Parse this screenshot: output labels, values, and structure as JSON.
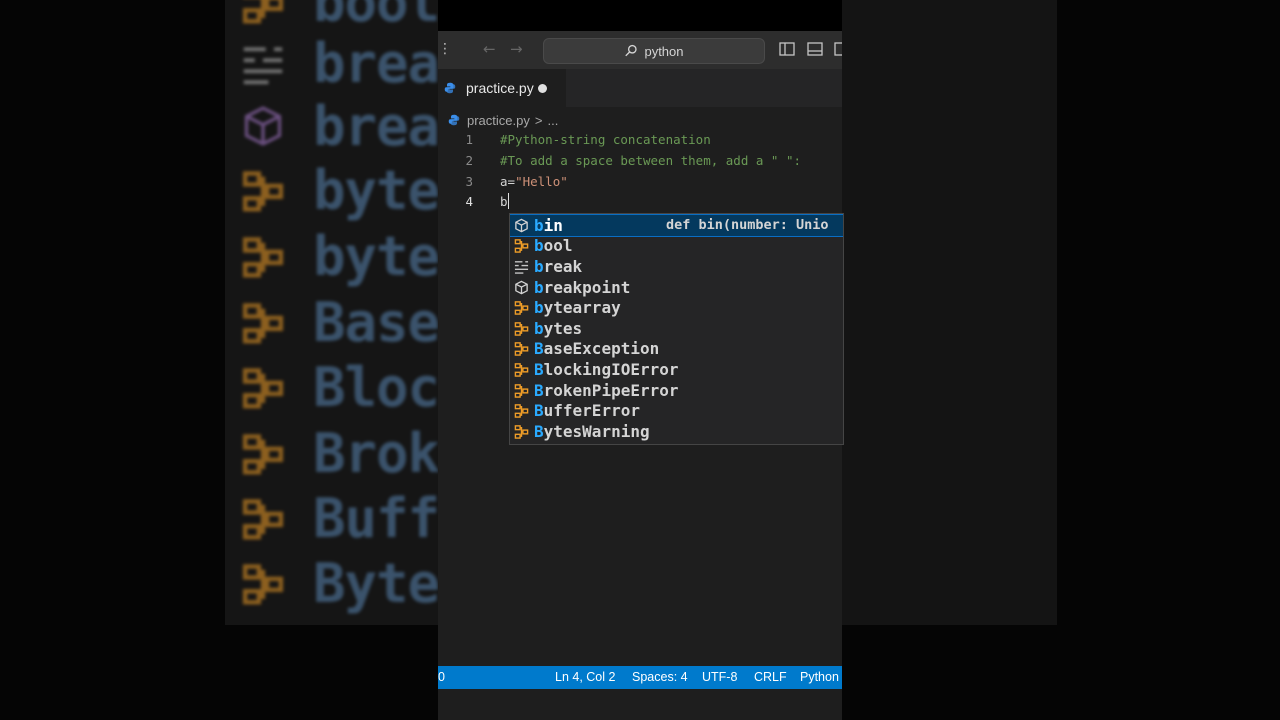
{
  "titlebar": {
    "search_text": "python"
  },
  "tab": {
    "filename": "practice.py",
    "modified": true
  },
  "breadcrumb": {
    "file": "practice.py",
    "separator": ">",
    "more": "..."
  },
  "code_lines": [
    {
      "number": "1",
      "text": "#Python-string concatenation"
    },
    {
      "number": "2",
      "text": "#To add a space between them, add a \" \":"
    },
    {
      "number": "3",
      "prefix": "a=",
      "string": "\"Hello\""
    },
    {
      "number": "4",
      "prefix": "b"
    }
  ],
  "suggest": {
    "detail": "def bin(number: Unio",
    "items": [
      {
        "label": "bin",
        "icon": "method-cube-icon"
      },
      {
        "label": "bool",
        "icon": "class-icon"
      },
      {
        "label": "break",
        "icon": "keyword-icon"
      },
      {
        "label": "breakpoint",
        "icon": "method-cube-icon"
      },
      {
        "label": "bytearray",
        "icon": "class-icon"
      },
      {
        "label": "bytes",
        "icon": "class-icon"
      },
      {
        "label": "BaseException",
        "icon": "class-icon"
      },
      {
        "label": "BlockingIOError",
        "icon": "class-icon"
      },
      {
        "label": "BrokenPipeError",
        "icon": "class-icon"
      },
      {
        "label": "BufferError",
        "icon": "class-icon"
      },
      {
        "label": "BytesWarning",
        "icon": "class-icon"
      }
    ]
  },
  "statusbar": {
    "left": "0",
    "position": "Ln 4, Col 2",
    "spaces": "Spaces: 4",
    "encoding": "UTF-8",
    "eol": "CRLF",
    "language": "Python"
  },
  "background": {
    "rows": [
      "bool",
      "brea",
      "brea",
      "byte",
      "byte",
      "Base",
      "Bloc",
      "Brok",
      "Buff",
      "Byte"
    ]
  },
  "colors": {
    "statusbar": "#007acc",
    "comment": "#6a9955",
    "string": "#ce9178",
    "match": "#2aaaff",
    "class_icon": "#ee9d28",
    "selection": "#04395e"
  }
}
